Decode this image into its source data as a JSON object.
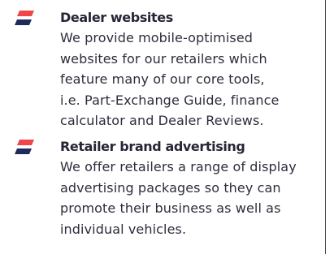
{
  "features": [
    {
      "icon": "brand-stripes-icon",
      "title": "Dealer websites",
      "lines": [
        "We provide mobile-optimised",
        "websites for our retailers which",
        "feature many of our core tools,",
        "i.e. Part-Exchange Guide, finance",
        "calculator and Dealer Reviews."
      ]
    },
    {
      "icon": "brand-stripes-icon",
      "title": "Retailer brand advertising",
      "lines": [
        "We offer retailers a range of display",
        "advertising packages so they can",
        "promote their business as well as",
        "individual vehicles."
      ]
    }
  ],
  "colors": {
    "stripe_top": "#f0454a",
    "stripe_bottom": "#1f2a5c",
    "text": "#2d2d3c"
  }
}
